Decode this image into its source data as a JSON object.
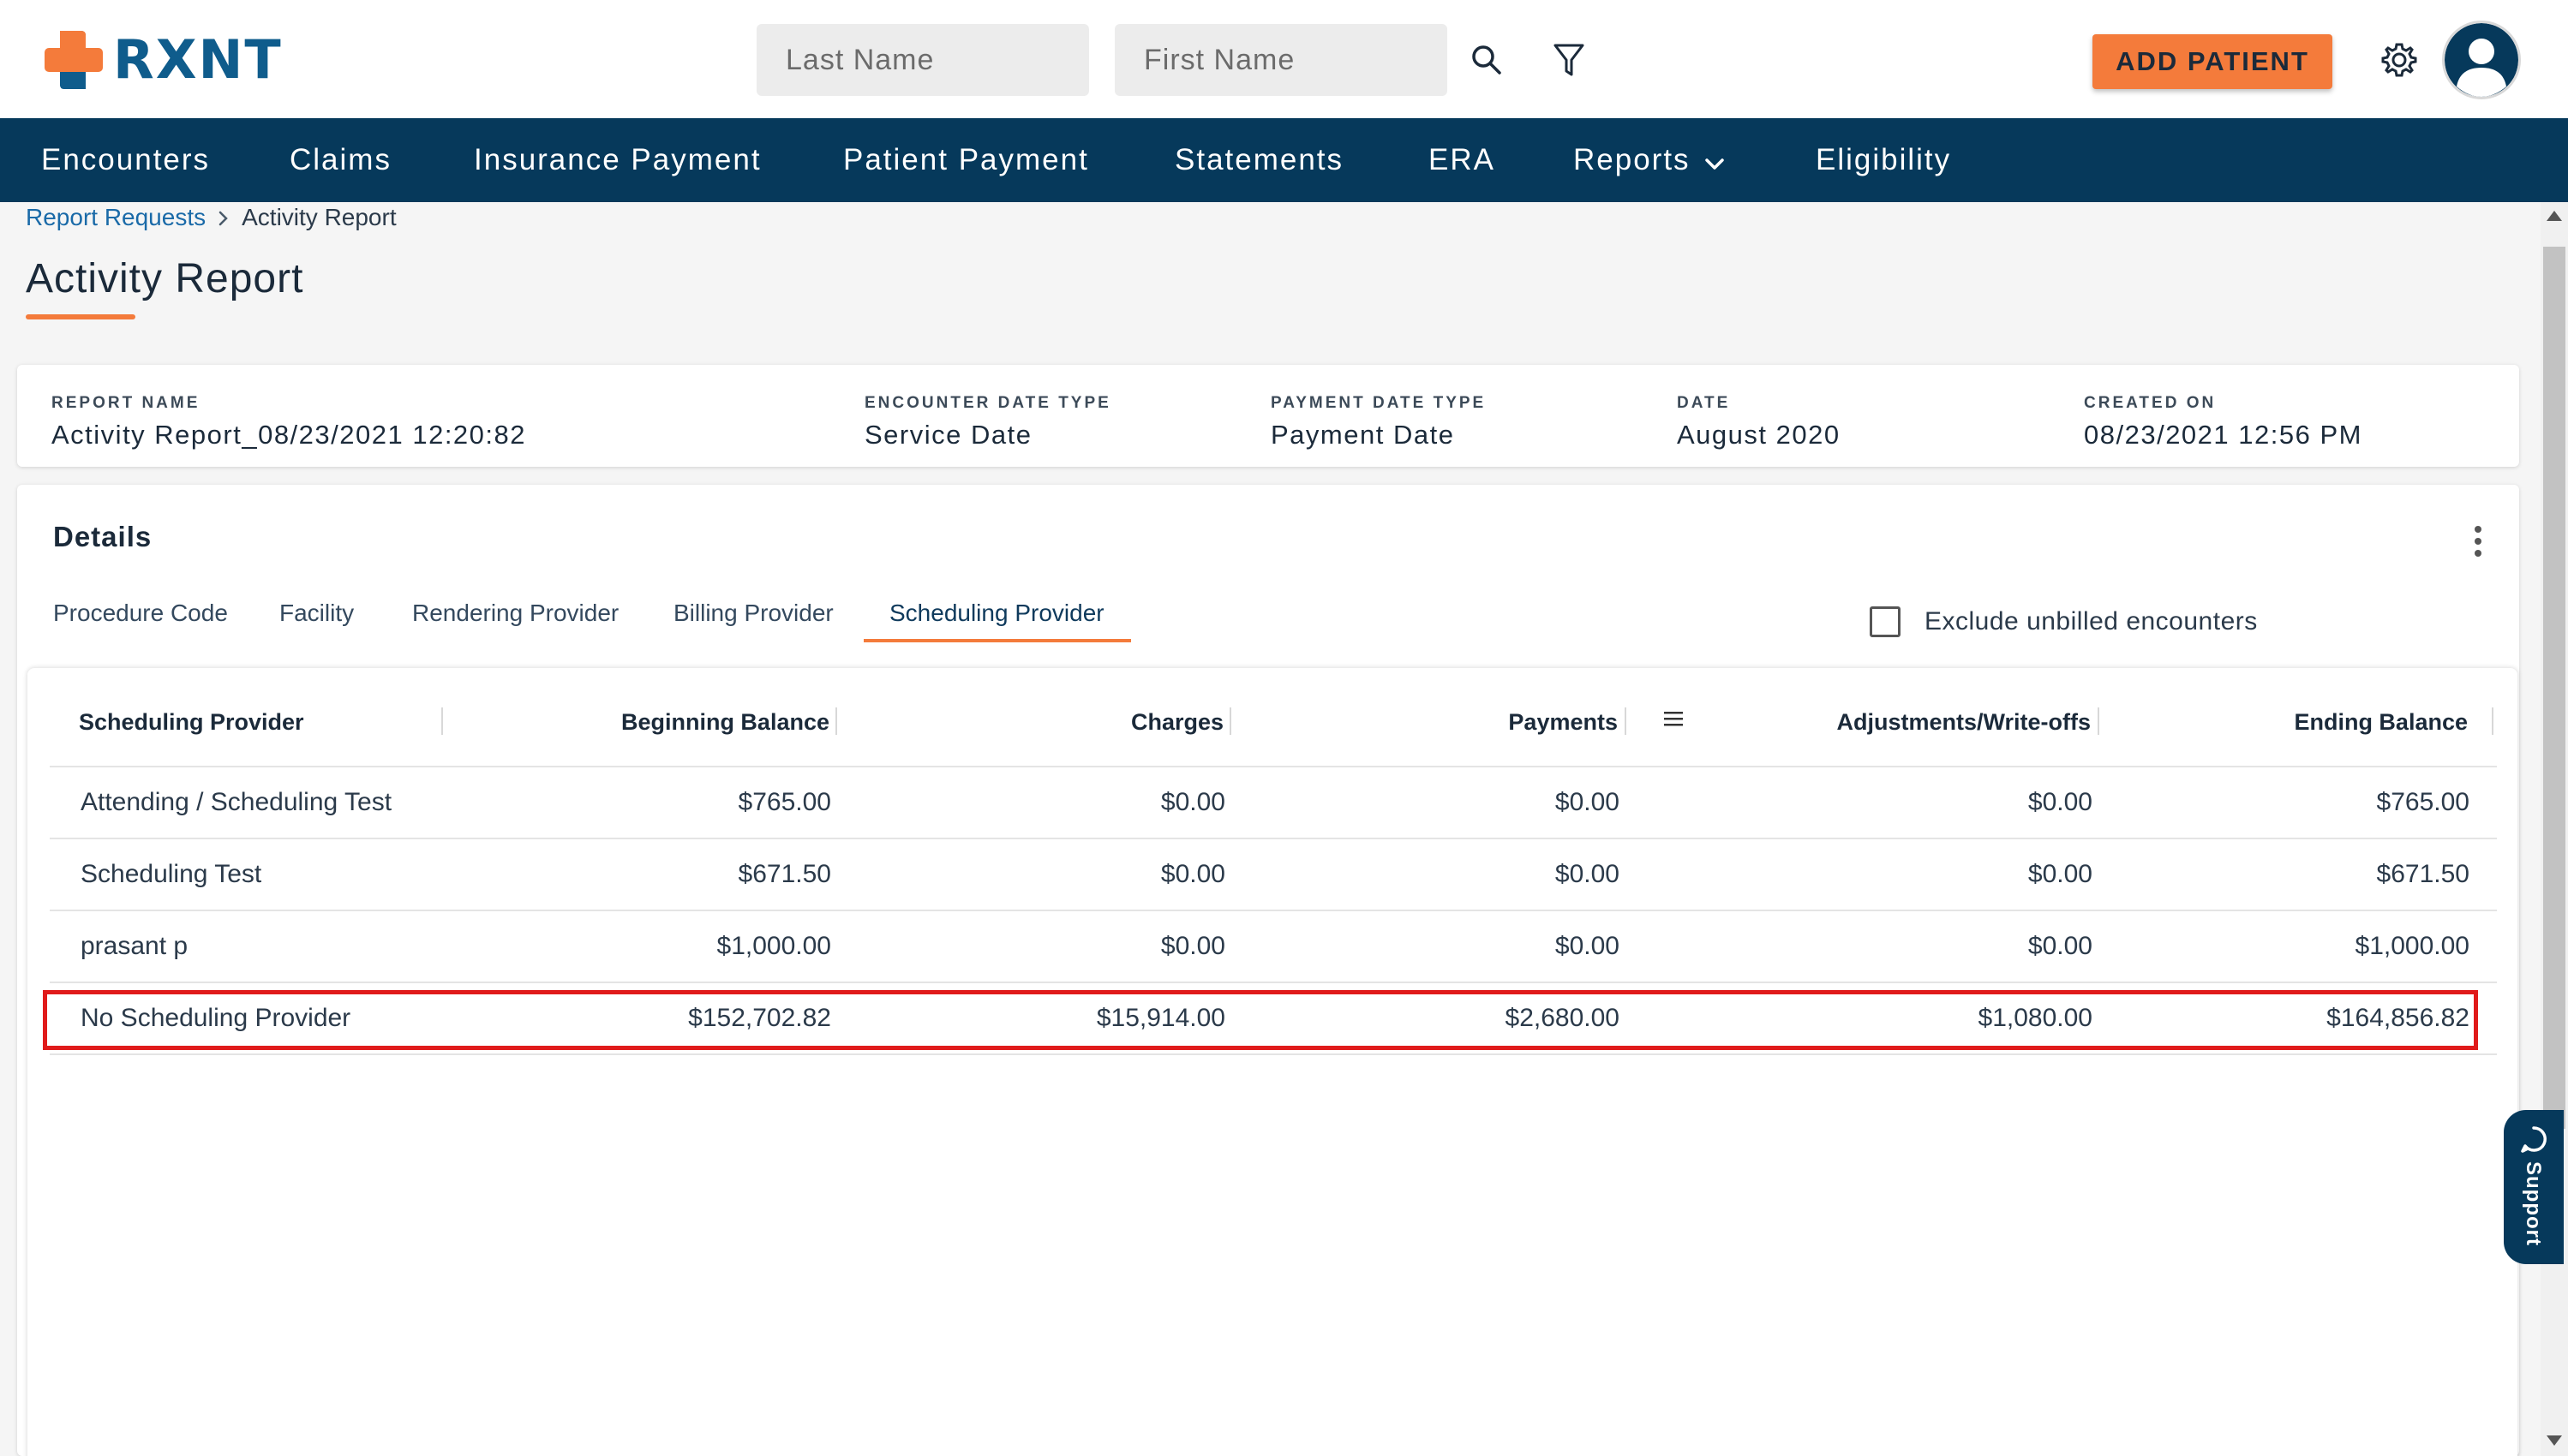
{
  "header": {
    "logo_text": "RXNT",
    "last_name_placeholder": "Last Name",
    "first_name_placeholder": "First Name",
    "add_patient_label": "ADD PATIENT"
  },
  "nav": {
    "items": [
      "Encounters",
      "Claims",
      "Insurance Payment",
      "Patient Payment",
      "Statements",
      "ERA",
      "Reports",
      "Eligibility"
    ]
  },
  "breadcrumb": {
    "parent": "Report Requests",
    "current": "Activity Report"
  },
  "page_title": "Activity Report",
  "summary": {
    "fields": [
      {
        "label": "REPORT NAME",
        "value": "Activity Report_08/23/2021 12:20:82"
      },
      {
        "label": "ENCOUNTER DATE TYPE",
        "value": "Service Date"
      },
      {
        "label": "PAYMENT DATE TYPE",
        "value": "Payment Date"
      },
      {
        "label": "DATE",
        "value": "August 2020"
      },
      {
        "label": "CREATED ON",
        "value": "08/23/2021 12:56 PM"
      }
    ]
  },
  "details": {
    "title": "Details",
    "tabs": [
      "Procedure Code",
      "Facility",
      "Rendering Provider",
      "Billing Provider",
      "Scheduling Provider"
    ],
    "active_tab": "Scheduling Provider",
    "exclude_label": "Exclude unbilled encounters",
    "exclude_checked": false
  },
  "table": {
    "columns": [
      "Scheduling Provider",
      "Beginning Balance",
      "Charges",
      "Payments",
      "Adjustments/Write-offs",
      "Ending Balance"
    ],
    "rows": [
      [
        "Attending / Scheduling Test",
        "$765.00",
        "$0.00",
        "$0.00",
        "$0.00",
        "$765.00"
      ],
      [
        "Scheduling Test",
        "$671.50",
        "$0.00",
        "$0.00",
        "$0.00",
        "$671.50"
      ],
      [
        "prasant p",
        "$1,000.00",
        "$0.00",
        "$0.00",
        "$0.00",
        "$1,000.00"
      ],
      [
        "No Scheduling Provider",
        "$152,702.82",
        "$15,914.00",
        "$2,680.00",
        "$1,080.00",
        "$164,856.82"
      ]
    ],
    "highlighted_row": 3
  },
  "support_label": "Support",
  "colors": {
    "brand_navy": "#06395b",
    "accent_orange": "#f47b3b",
    "logo_blue": "#0f5c8c",
    "highlight_red": "#e01b1b"
  },
  "icons": [
    "search-icon",
    "filter-icon",
    "gear-icon",
    "user-avatar-icon",
    "chevron-down-icon",
    "chevron-right-icon",
    "kebab-menu-icon",
    "column-menu-icon",
    "support-chat-icon"
  ]
}
